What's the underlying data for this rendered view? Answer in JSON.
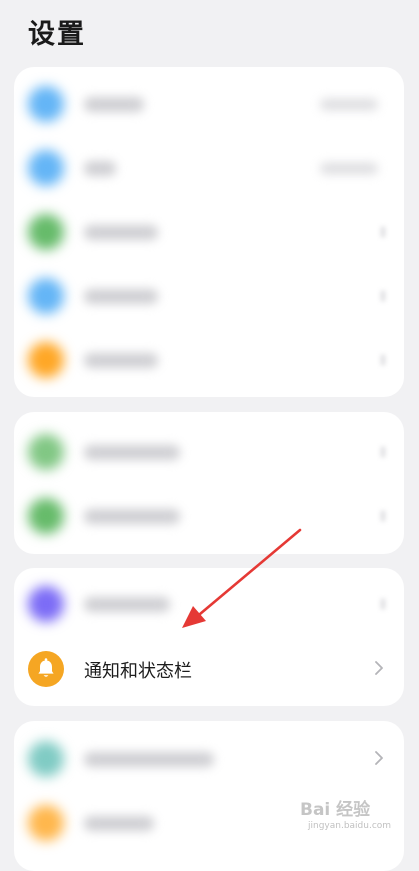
{
  "page": {
    "title": "设置"
  },
  "cards": [
    {
      "rows": [
        {
          "icon": "blurred-setting-icon",
          "color": "#64b5f6",
          "label": "",
          "value": ""
        },
        {
          "icon": "blurred-setting-icon",
          "color": "#64b5f6",
          "label": "",
          "value": ""
        },
        {
          "icon": "blurred-setting-icon",
          "color": "#66bb6a",
          "label": "",
          "value": ""
        },
        {
          "icon": "blurred-setting-icon",
          "color": "#64b5f6",
          "label": "",
          "value": ""
        },
        {
          "icon": "blurred-setting-icon",
          "color": "#ffa726",
          "label": "",
          "value": ""
        }
      ]
    },
    {
      "rows": [
        {
          "icon": "blurred-setting-icon",
          "color": "#81c784",
          "label": ""
        },
        {
          "icon": "blurred-setting-icon",
          "color": "#66bb6a",
          "label": ""
        }
      ]
    },
    {
      "rows": [
        {
          "icon": "blurred-setting-icon",
          "color": "#7c6cf6",
          "label": ""
        },
        {
          "icon": "bell-icon",
          "color": "#f5a623",
          "label": "通知和状态栏"
        }
      ]
    },
    {
      "rows": [
        {
          "icon": "blurred-setting-icon",
          "color": "#80cbc4",
          "label": ""
        },
        {
          "icon": "blurred-setting-icon",
          "color": "#ffb74d",
          "label": ""
        }
      ]
    }
  ],
  "annotation": {
    "type": "arrow",
    "color": "#e53935"
  },
  "watermark": {
    "text": "Bai 经验",
    "url": "jingyan.baidu.com"
  }
}
